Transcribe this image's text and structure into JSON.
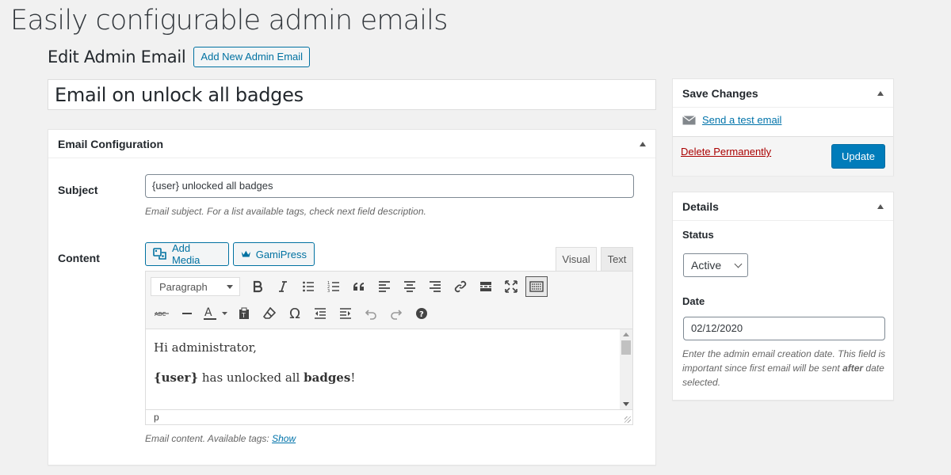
{
  "hero": {
    "title": "Easily configurable admin emails"
  },
  "page": {
    "heading": "Edit Admin Email",
    "add_new_label": "Add New Admin Email"
  },
  "title_field": {
    "value": "Email on unlock all badges"
  },
  "email_config": {
    "title": "Email Configuration",
    "subject": {
      "label": "Subject",
      "value": "{user} unlocked all badges",
      "description": "Email subject. For a list available tags, check next field description."
    },
    "content": {
      "label": "Content",
      "add_media_label": "Add Media",
      "gamipress_label": "GamiPress",
      "tab_visual": "Visual",
      "tab_text": "Text",
      "format_select": "Paragraph",
      "body": {
        "line1": "Hi administrator,",
        "tag_user": "{user}",
        "text_mid": " has unlocked all ",
        "bold_badges": "badges",
        "text_end": "!"
      },
      "status_path": "p",
      "description": "Email content. Available tags: ",
      "show_link": "Show"
    }
  },
  "save_box": {
    "title": "Save Changes",
    "test_email_link": "Send a test email",
    "delete_link": "Delete Permanently",
    "update_label": "Update"
  },
  "details_box": {
    "title": "Details",
    "status_label": "Status",
    "status_value": "Active",
    "date_label": "Date",
    "date_value": "02/12/2020",
    "date_desc_1": "Enter the admin email creation date. This field is important since first email will be sent ",
    "date_desc_bold": "after",
    "date_desc_2": " date selected."
  },
  "colors": {
    "accent": "#0071a1",
    "primary_button": "#007cba",
    "delete": "#aa0000",
    "link": "#0073aa"
  }
}
